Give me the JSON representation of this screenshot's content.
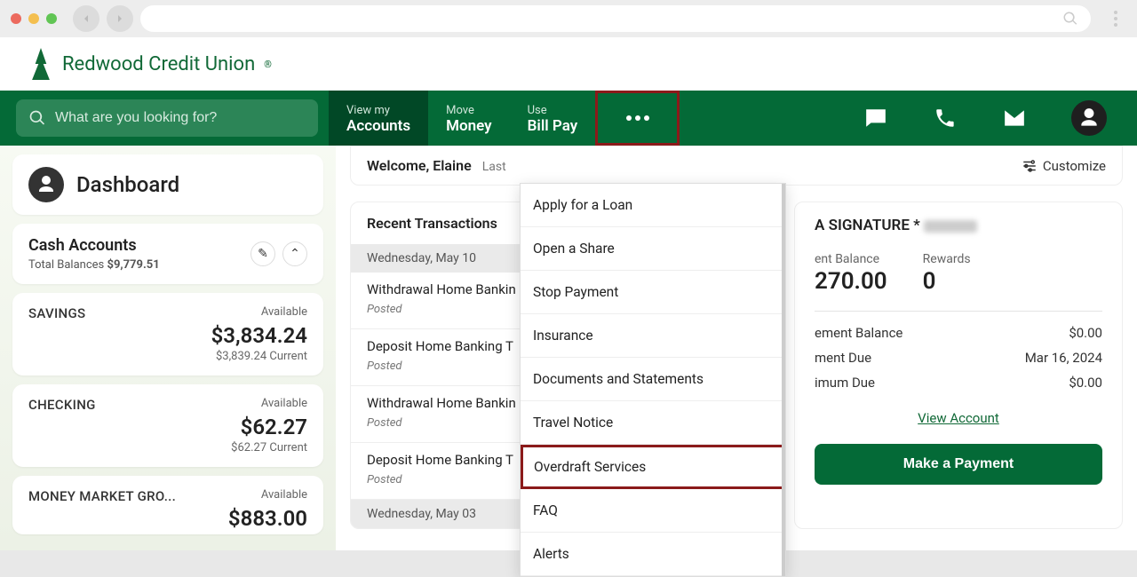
{
  "brand": {
    "name": "Redwood Credit Union"
  },
  "search": {
    "placeholder": "What are you looking for?"
  },
  "nav": {
    "tabs": [
      {
        "small": "View my",
        "big": "Accounts"
      },
      {
        "small": "Move",
        "big": "Money"
      },
      {
        "small": "Use",
        "big": "Bill Pay"
      }
    ]
  },
  "dashboard": {
    "title": "Dashboard"
  },
  "cash": {
    "title": "Cash Accounts",
    "subLabel": "Total Balances",
    "subValue": "$9,779.51"
  },
  "accounts": [
    {
      "name": "SAVINGS",
      "availLabel": "Available",
      "amount": "$3,834.24",
      "current": "$3,839.24 Current"
    },
    {
      "name": "CHECKING",
      "availLabel": "Available",
      "amount": "$62.27",
      "current": "$62.27 Current"
    },
    {
      "name": "MONEY MARKET GRO...",
      "availLabel": "Available",
      "amount": "$883.00",
      "current": ""
    }
  ],
  "welcome": {
    "greeting": "Welcome, Elaine",
    "lastLabel": "Last ",
    "customize": "Customize"
  },
  "recent": {
    "header": "Recent Transactions",
    "groups": [
      {
        "date": "Wednesday, May 10",
        "items": [
          {
            "title": "Withdrawal Home Bankin",
            "status": "Posted"
          },
          {
            "title": "Deposit Home Banking T",
            "status": "Posted"
          },
          {
            "title": "Withdrawal Home Bankin",
            "status": "Posted"
          },
          {
            "title": "Deposit Home Banking T",
            "status": "Posted"
          }
        ]
      },
      {
        "date": "Wednesday, May 03",
        "items": []
      }
    ]
  },
  "credit": {
    "namePrefix": "A SIGNATURE *",
    "balLabel": "ent Balance",
    "balValue": "270.00",
    "rewardsLabel": "Rewards",
    "rewardsValue": "0",
    "lines": [
      {
        "label": "ement Balance",
        "value": "$0.00"
      },
      {
        "label": "ment Due",
        "value": "Mar 16, 2024"
      },
      {
        "label": "imum Due",
        "value": "$0.00"
      }
    ],
    "viewLink": "View Account",
    "payButton": "Make a Payment"
  },
  "dropdown": [
    "Apply for a Loan",
    "Open a Share",
    "Stop Payment",
    "Insurance",
    "Documents and Statements",
    "Travel Notice",
    "Overdraft Services",
    "FAQ",
    "Alerts"
  ]
}
